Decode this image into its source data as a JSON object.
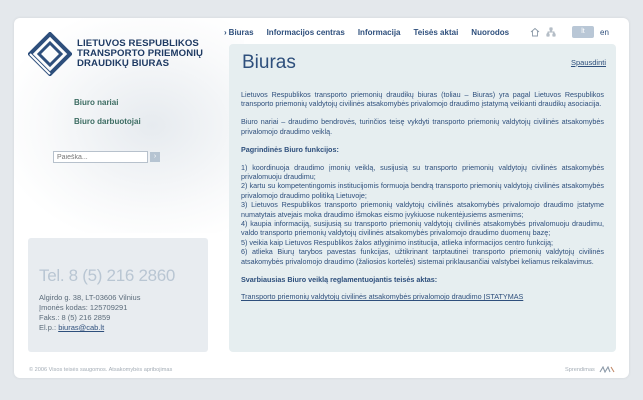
{
  "logo": {
    "lines": [
      "LIETUVOS RESPUBLIKOS",
      "TRANSPORTO PRIEMONIŲ",
      "DRAUDIKŲ BIURAS"
    ]
  },
  "topnav": {
    "items": [
      "Biuras",
      "Informacijos centras",
      "Informacija",
      "Teisės aktai",
      "Nuorodos"
    ]
  },
  "util": {
    "icons": [
      "home-icon",
      "sitemap-icon"
    ]
  },
  "lang": {
    "lt": "lt",
    "en": "en"
  },
  "sidenav": {
    "items": [
      "Biuro nariai",
      "Biuro darbuotojai"
    ]
  },
  "search": {
    "value": "Paieška...",
    "go": "›"
  },
  "contact": {
    "phone": "Tel. 8 (5) 216 2860",
    "address": "Algirdo g. 38, LT-03606 Vilnius",
    "code": "Įmonės kodas: 125709291",
    "fax": "Faks.: 8 (5) 216 2859",
    "email_label": "El.p.:",
    "email": "biuras@cab.lt"
  },
  "main": {
    "title": "Biuras",
    "print": "Spausdinti",
    "intro": "Lietuvos Respublikos transporto priemonių draudikų biuras (toliau – Biuras) yra pagal Lietuvos Respublikos transporto priemonių valdytojų civilinės atsakomybės privalomojo draudimo įstatymą veikianti draudikų asociacija.",
    "members": "Biuro nariai – draudimo bendrovės, turinčios teisę vykdyti transporto priemonių valdytojų civilinės atsakomybės privalomojo draudimo veiklą.",
    "functions_title": "Pagrindinės Biuro funkcijos:",
    "functions": [
      "1) koordinuoja draudimo įmonių veiklą, susijusią su transporto priemonių valdytojų civilinės atsakomybės privalomuoju draudimu;",
      "2) kartu su kompetentingomis institucijomis formuoja bendrą transporto priemonių valdytojų civilinės atsakomybės privalomojo draudimo politiką Lietuvoje;",
      "3) Lietuvos Respublikos transporto priemonių valdytojų civilinės atsakomybės privalomojo draudimo įstatyme numatytais atvejais moka draudimo išmokas eismo įvykiuose nukentėjusiems asmenims;",
      "4) kaupia informaciją, susijusią su transporto priemonių valdytojų civilinės atsakomybės privalomuoju draudimu, valdo transporto priemonių valdytojų civilinės atsakomybės privalomojo draudimo duomenų bazę;",
      "5) veikia kaip Lietuvos Respublikos žalos atlyginimo institucija, atlieka informacijos centro funkciją;",
      "6) atlieka Biurų tarybos pavestas funkcijas, užtikrinant tarptautinei transporto priemonių valdytojų civilinės atsakomybės privalomojo draudimo (žaliosios kortelės) sistemai priklausančiai valstybei keliamus reikalavimus."
    ],
    "law_title": "Svarbiausias Biuro veiklą reglamentuojantis teisės aktas:",
    "law_link": "Transporto priemonių valdytojų civilinės atsakomybės privalomojo draudimo ĮSTATYMAS"
  },
  "footer": {
    "copyright": "© 2006 Visos teisės saugomos. Atsakomybės apribojimas",
    "made_by": "Sprendimas"
  }
}
